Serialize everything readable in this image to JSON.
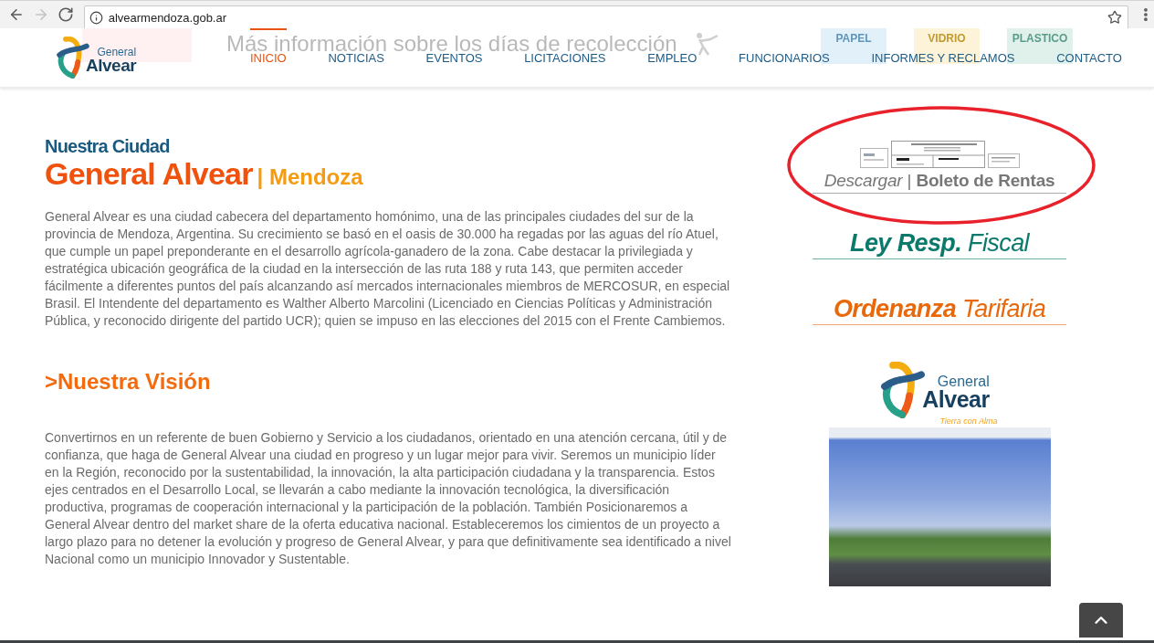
{
  "browser": {
    "url": "alvearmendoza.gob.ar",
    "back_enabled": true,
    "forward_enabled": false
  },
  "header": {
    "logo": {
      "line_1": "General",
      "line_2": "Alvear"
    },
    "banner": {
      "headline": "Más información sobre los días de recolección",
      "bins": [
        {
          "label": "PAPEL",
          "color": "#e2f0fa"
        },
        {
          "label": "VIDRIO",
          "color": "#fcf3d9"
        },
        {
          "label": "PLASTICO",
          "color": "#e0f1ec"
        }
      ]
    },
    "nav": [
      {
        "label": "INICIO",
        "selected": true
      },
      {
        "label": "NOTICIAS",
        "selected": false
      },
      {
        "label": "EVENTOS",
        "selected": false
      },
      {
        "label": "LICITACIONES",
        "selected": false
      },
      {
        "label": "EMPLEO",
        "selected": false
      },
      {
        "label": "FUNCIONARIOS",
        "selected": false
      },
      {
        "label": "INFORMES Y RECLAMOS",
        "selected": false
      },
      {
        "label": "CONTACTO",
        "selected": false
      }
    ]
  },
  "intro": {
    "kicker": "Nuestra Ciudad",
    "title": "General Alvear",
    "subtitle": "| Mendoza",
    "text": "General Alvear es una ciudad cabecera del departamento homónimo, una de las principales ciudades del sur de la provincia de Mendoza, Argentina. Su crecimiento se basó en el oasis de 30.000 ha regadas por las aguas del río Atuel, que cumple un papel preponderante en el desarrollo agrícola-ganadero de la zona. Cabe destacar la privilegiada y estratégica ubicación geográfica de la ciudad en la intersección de las ruta 188 y ruta 143, que permiten acceder fácilmente a diferentes puntos del país alcanzando así mercados internacionales miembros de MERCOSUR, en especial Brasil. El Intendente del departamento es Walther Alberto Marcolini (Licenciado en Ciencias Políticas y Administración Pública, y reconocido dirigente del partido UCR); quien se impuso en las elecciones del 2015 con el Frente Cambiemos."
  },
  "vision": {
    "title": ">Nuestra Visión",
    "text": "Convertirnos en un referente de buen Gobierno y Servicio a los ciudadanos, orientado en una atención cercana, útil y de confianza, que haga de General Alvear una ciudad en progreso y un lugar mejor para vivir. Seremos un municipio líder en la Región, reconocido por la sustentabilidad, la innovación, la alta participación ciudadana y la transparencia. Estos ejes centrados en el Desarrollo Local, se llevarán a cabo mediante la innovación tecnológica, la diversificación productiva, programas de cooperación internacional y la participación de la población. También Posicionaremos a General Alvear dentro del market share de la oferta educativa nacional. Estableceremos los cimientos de un proyecto a largo plazo para no detener la evolución y progreso de General Alvear, y para que definitivamente sea identificado a nivel Nacional como un municipio Innovador y Sustentable."
  },
  "sidebar": {
    "links": [
      {
        "kind": "download",
        "text": "*Descargar* | **Boleto de Rentas**",
        "color": "#777777",
        "highlighted": true
      },
      {
        "kind": "document",
        "text": "**Ley Resp.** Fiscal",
        "color": "#0b7a6c",
        "highlighted": false
      },
      {
        "kind": "document",
        "text": "**Ordenanza** Tarifaria",
        "color": "#e8680c",
        "highlighted": false
      }
    ],
    "promo": {
      "line_1": "General",
      "line_2": "Alvear",
      "tagline": "Tierra con Alma"
    }
  }
}
